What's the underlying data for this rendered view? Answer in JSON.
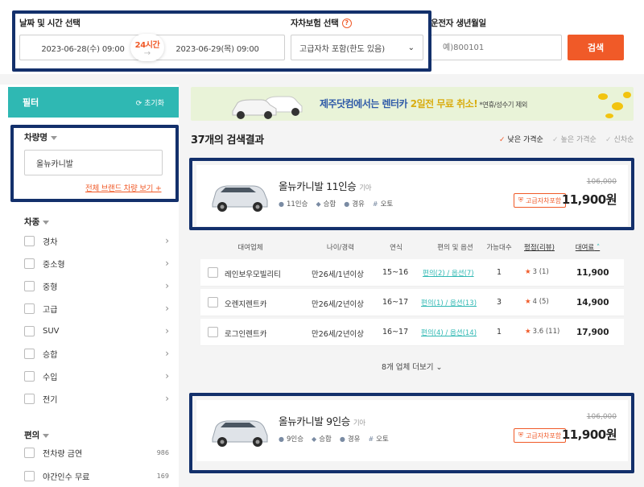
{
  "search": {
    "datetime_label": "날짜 및 시간 선택",
    "start": "2023-06-28(수) 09:00",
    "end": "2023-06-29(목) 09:00",
    "duration": "24시간",
    "insurance_label": "자차보험 선택",
    "insurance_help": "?",
    "insurance_value": "고급자차 포함(한도 있음)",
    "birth_label": "운전자 생년월일",
    "birth_placeholder": "예)800101",
    "search_button": "검색"
  },
  "sidebar": {
    "title": "필터",
    "reset": "초기화",
    "carname_title": "차량명",
    "carname_value": "올뉴카니발",
    "brand_link": "전체 브랜드 차량 보기 +",
    "type_title": "차종",
    "types": [
      {
        "label": "경차"
      },
      {
        "label": "중소형"
      },
      {
        "label": "중형"
      },
      {
        "label": "고급"
      },
      {
        "label": "SUV"
      },
      {
        "label": "승합"
      },
      {
        "label": "수입"
      },
      {
        "label": "전기"
      }
    ],
    "conv_title": "편의",
    "conv": [
      {
        "label": "전차량 금연",
        "count": "986"
      },
      {
        "label": "야간인수 무료",
        "count": "169"
      }
    ]
  },
  "banner": {
    "text_a": "제주닷컴에서는 ",
    "text_b": "렌터카 ",
    "text_c": "2일전 무료 취소!",
    "text_d": " *연휴/성수기 제외"
  },
  "results": {
    "count_text": "37개의 검색결과",
    "sort": [
      "낮은 가격순",
      "높은 가격순",
      "신차순"
    ]
  },
  "cars": [
    {
      "name": "올뉴카니발 11인승",
      "maker": "기아",
      "seats": "11인승",
      "class": "승합",
      "fuel": "경유",
      "option": "오토",
      "orig_price": "106,000",
      "badge": "고급자차포함",
      "price": "11,900원"
    },
    {
      "name": "올뉴카니발 9인승",
      "maker": "기아",
      "seats": "9인승",
      "class": "승합",
      "fuel": "경유",
      "option": "오토",
      "orig_price": "106,000",
      "badge": "고급자차포함",
      "price": "11,900원"
    }
  ],
  "table": {
    "headers": [
      "대여업체",
      "나이/경력",
      "연식",
      "편의 및 옵션",
      "가능대수",
      "평점(리뷰)",
      "대여료"
    ],
    "rows": [
      {
        "company": "레인보우모빌리티",
        "age": "만26세/1년이상",
        "year": "15~16",
        "conv": "편의(2) / 옵션(7)",
        "avail": "1",
        "rating": "3 (1)",
        "price": "11,900"
      },
      {
        "company": "오렌지렌트카",
        "age": "만26세/2년이상",
        "year": "16~17",
        "conv": "편의(1) / 옵션(13)",
        "avail": "3",
        "rating": "4 (5)",
        "price": "14,900"
      },
      {
        "company": "로그인렌트카",
        "age": "만26세/2년이상",
        "year": "16~17",
        "conv": "편의(4) / 옵션(14)",
        "avail": "1",
        "rating": "3.6 (11)",
        "price": "17,900"
      }
    ],
    "more": "8개 업체 더보기 ⌄"
  },
  "colors": {
    "accent": "#f05a28",
    "teal": "#2fb8b3",
    "highlight": "#13306b"
  }
}
